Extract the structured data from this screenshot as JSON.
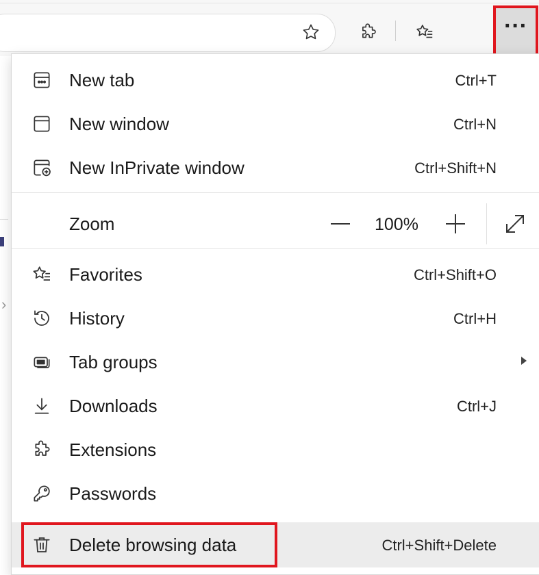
{
  "toolbar": {
    "favorite_star_icon": "star-outline",
    "extensions_icon": "puzzle",
    "favorites_icon": "star-list",
    "more_label": "···"
  },
  "menu": {
    "items": [
      {
        "label": "New tab",
        "shortcut": "Ctrl+T",
        "icon": "new-tab"
      },
      {
        "label": "New window",
        "shortcut": "Ctrl+N",
        "icon": "window"
      },
      {
        "label": "New InPrivate window",
        "shortcut": "Ctrl+Shift+N",
        "icon": "inprivate"
      },
      {
        "label": "Favorites",
        "shortcut": "Ctrl+Shift+O",
        "icon": "favorites"
      },
      {
        "label": "History",
        "shortcut": "Ctrl+H",
        "icon": "history"
      },
      {
        "label": "Tab groups",
        "shortcut": "",
        "icon": "tab-groups"
      },
      {
        "label": "Downloads",
        "shortcut": "Ctrl+J",
        "icon": "download"
      },
      {
        "label": "Extensions",
        "shortcut": "",
        "icon": "puzzle"
      },
      {
        "label": "Passwords",
        "shortcut": "",
        "icon": "key"
      },
      {
        "label": "Delete browsing data",
        "shortcut": "Ctrl+Shift+Delete",
        "icon": "trash"
      }
    ],
    "zoom": {
      "label": "Zoom",
      "value": "100%",
      "zoom_out_icon": "minus",
      "zoom_in_icon": "plus",
      "fullscreen_icon": "expand"
    }
  },
  "colors": {
    "highlight_border": "#e0161e",
    "hover_background": "#ececec"
  }
}
